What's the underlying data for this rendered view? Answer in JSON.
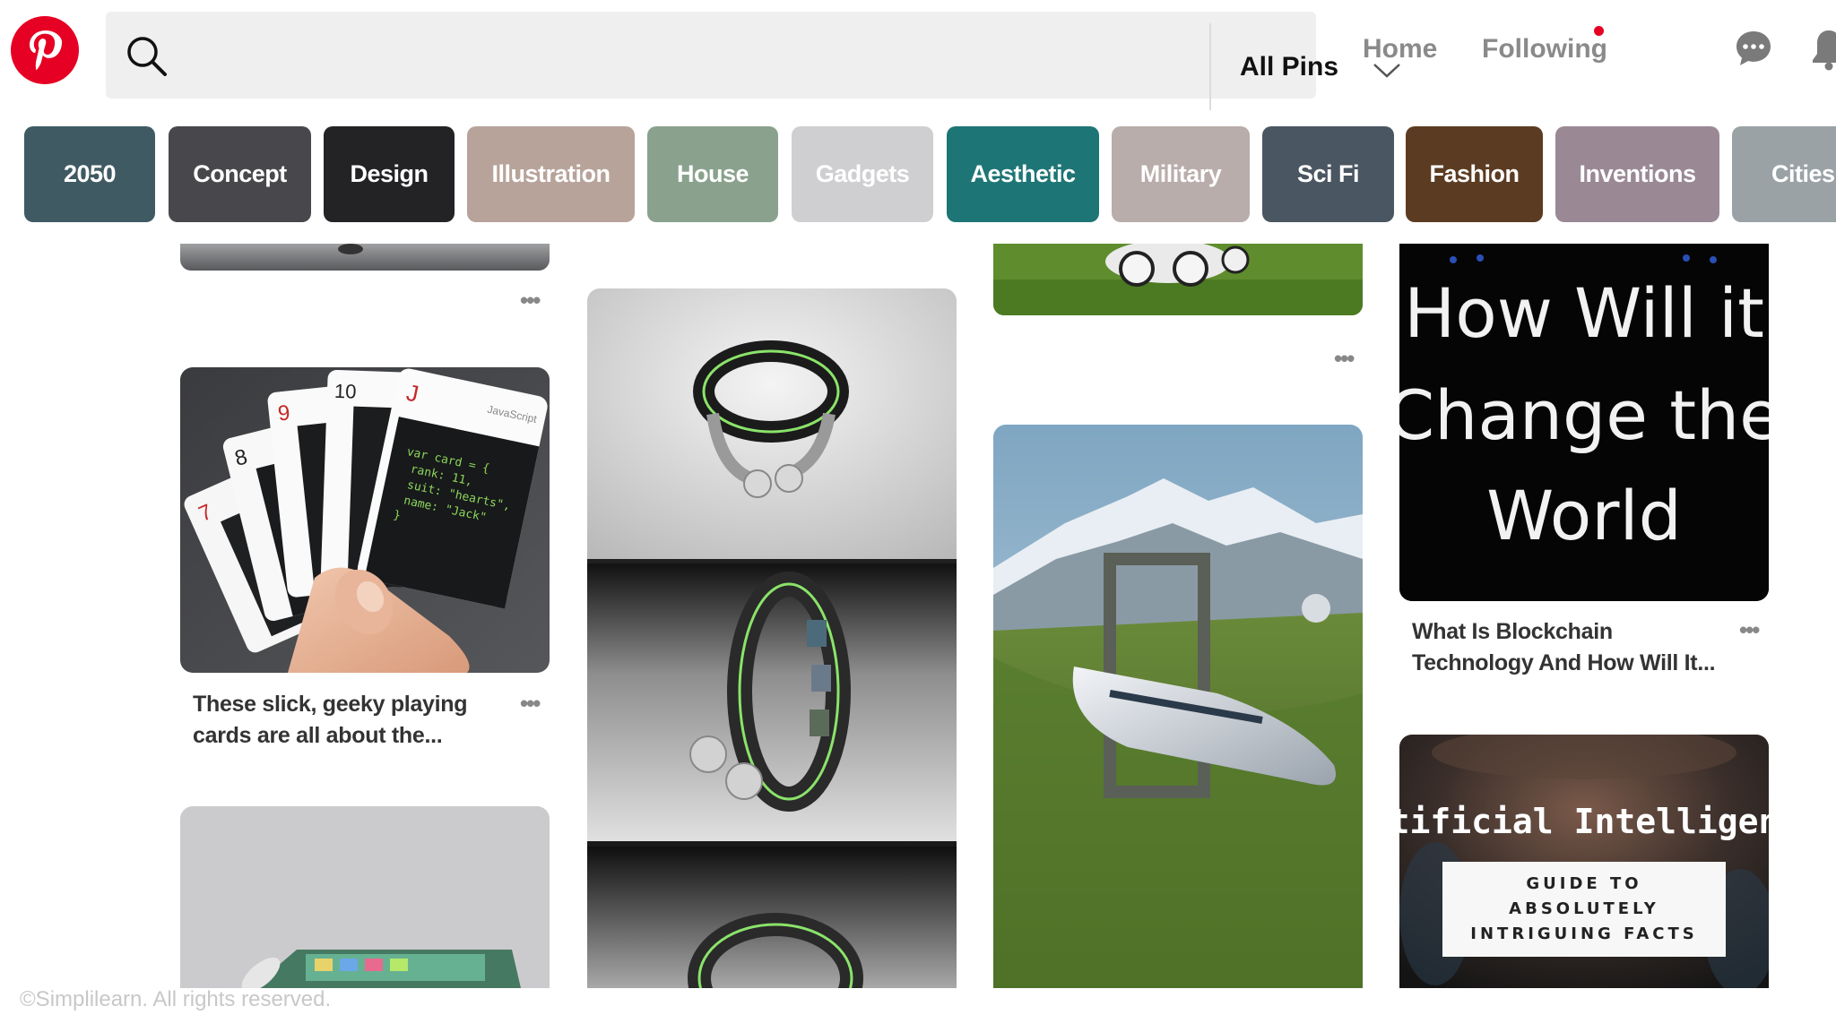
{
  "header": {
    "search_placeholder": "",
    "scope_label": "All Pins",
    "nav": {
      "home": "Home",
      "following": "Following"
    }
  },
  "chips": [
    {
      "label": "2050",
      "color": "#3f5a63"
    },
    {
      "label": "Concept",
      "color": "#48484c"
    },
    {
      "label": "Design",
      "color": "#232326"
    },
    {
      "label": "Illustration",
      "color": "#b7a39a"
    },
    {
      "label": "House",
      "color": "#8aa28d"
    },
    {
      "label": "Gadgets",
      "color": "#cfcfd2"
    },
    {
      "label": "Aesthetic",
      "color": "#1e7575"
    },
    {
      "label": "Military",
      "color": "#b9adab"
    },
    {
      "label": "Sci Fi",
      "color": "#4a5661"
    },
    {
      "label": "Fashion",
      "color": "#5b3c22"
    },
    {
      "label": "Inventions",
      "color": "#9a8994"
    },
    {
      "label": "Cities",
      "color": "#9aa2a6"
    }
  ],
  "pins": {
    "cards_caption": "These slick, geeky playing cards are all about the...",
    "blockchain_title_lines": [
      "How Will it",
      "Change the",
      "World"
    ],
    "blockchain_caption": "What Is Blockchain Technology And How Will It...",
    "ai_title": "Artificial Intelligence",
    "ai_subtitle_lines": [
      "GUIDE TO",
      "ABSOLUTELY",
      "INTRIGUING FACTS"
    ],
    "card_code_lines": [
      "var card = {",
      "rank: 11,",
      "suit: \"hearts\",",
      "name: \"Jack\"",
      "}"
    ],
    "card_ranks": [
      "7",
      "8",
      "9",
      "10",
      "J"
    ],
    "card_brand": "JavaScript"
  },
  "footer": {
    "watermark": "©Simplilearn. All rights reserved."
  },
  "icons": {
    "logo": "pinterest-logo",
    "search": "search-icon",
    "chevron": "chevron-down-icon",
    "messages": "chat-bubble-icon",
    "notifications": "bell-icon"
  }
}
